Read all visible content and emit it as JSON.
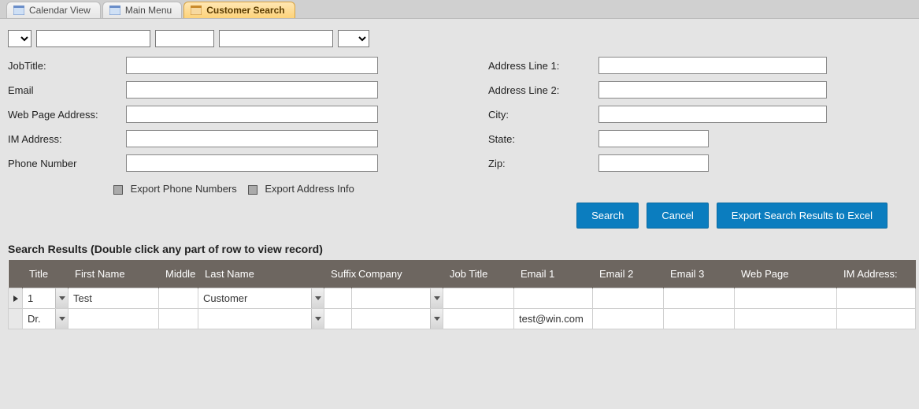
{
  "tabs": [
    {
      "label": "Calendar View",
      "active": false
    },
    {
      "label": "Main Menu",
      "active": false
    },
    {
      "label": "Customer Search",
      "active": true
    }
  ],
  "topRow": {
    "titleCombo": "",
    "firstName": "",
    "middle": "",
    "lastName": "",
    "suffixCombo": ""
  },
  "left": {
    "jobTitleLabel": "JobTitle:",
    "jobTitle": "",
    "emailLabel": "Email",
    "email": "",
    "webLabel": "Web Page Address:",
    "web": "",
    "imLabel": "IM Address:",
    "im": "",
    "phoneLabel": "Phone Number",
    "phone": ""
  },
  "right": {
    "addr1Label": "Address Line 1:",
    "addr1": "",
    "addr2Label": "Address Line 2:",
    "addr2": "",
    "cityLabel": "City:",
    "city": "",
    "stateLabel": "State:",
    "state": "",
    "zipLabel": "Zip:",
    "zip": ""
  },
  "checks": {
    "exportPhone": "Export Phone Numbers",
    "exportAddr": "Export Address Info"
  },
  "buttons": {
    "search": "Search",
    "cancel": "Cancel",
    "export": "Export Search Results to Excel"
  },
  "resultsTitle": "Search Results (Double click any part of row to view record)",
  "columns": {
    "title": "Title",
    "first": "First Name",
    "middle": "Middle",
    "last": "Last Name",
    "suffix": "Suffix",
    "company": "Company",
    "job": "Job Title",
    "em1": "Email 1",
    "em2": "Email 2",
    "em3": "Email 3",
    "web": "Web Page",
    "im": "IM Address:"
  },
  "rows": [
    {
      "current": true,
      "title": "1",
      "first": "Test",
      "middle": "",
      "last": "Customer",
      "suffix": "",
      "company": "",
      "job": "",
      "em1": "",
      "em2": "",
      "em3": "",
      "web": "",
      "im": ""
    },
    {
      "current": false,
      "title": "Dr.",
      "first": "",
      "middle": "",
      "last": "",
      "suffix": "",
      "company": "",
      "job": "",
      "em1": "test@win.com",
      "em2": "",
      "em3": "",
      "web": "",
      "im": ""
    }
  ]
}
